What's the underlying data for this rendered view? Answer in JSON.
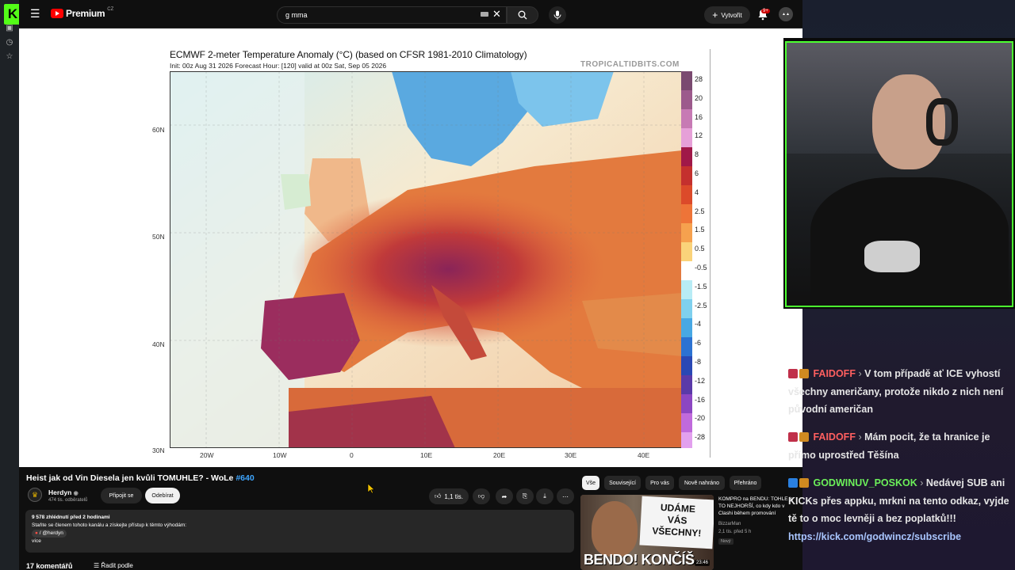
{
  "topbar": {
    "brand": "Premium",
    "region": "CZ",
    "search_value": "g mma",
    "create_label": "Vytvořit",
    "notif_count": "9+"
  },
  "map": {
    "title": "ECMWF 2-meter Temperature Anomaly (°C) (based on CFSR 1981-2010 Climatology)",
    "subtitle": "Init: 00z Aug 31 2026   Forecast Hour: [120]   valid at 00z Sat, Sep 05 2026",
    "credit": "TROPICALTIDBITS.COM",
    "colorbar_labels": [
      "28",
      "20",
      "16",
      "12",
      "8",
      "6",
      "4",
      "2.5",
      "1.5",
      "0.5",
      "-0.5",
      "-1.5",
      "-2.5",
      "-4",
      "-6",
      "-8",
      "-12",
      "-16",
      "-20",
      "-28"
    ],
    "lat_labels": [
      "60N",
      "50N",
      "40N",
      "30N"
    ],
    "lon_labels": [
      "20W",
      "10W",
      "0",
      "10E",
      "20E",
      "30E",
      "40E"
    ]
  },
  "video": {
    "title": "Heist jak od Vin Diesela jen kvůli TOMUHLE? - WoLe",
    "title_tag": "#640",
    "channel": "Herdyn",
    "subscribers": "474 tis. odběratelů",
    "join_label": "Připojit se",
    "subscribe_label": "Odebírat",
    "likes": "1,1 tis.",
    "views_line": "9 578 zhlédnutí  před 2 hodinami",
    "desc_line": "Staňte se členem tohoto kanálu a získejte přístup k těmto výhodám:",
    "desc_handle": "/ @herdyn",
    "more_label": "více",
    "comments": "17 komentářů",
    "sort_label": "Řadit podle"
  },
  "related": {
    "chips": [
      "Vše",
      "Související",
      "Pro vás",
      "Nově nahráno",
      "Přehráno"
    ],
    "title": "KOMPRO na BENDU: TOHLE je TO NEJHORŠÍ, co kdy kdo v Clashi během promování",
    "channel": "BizzarMan",
    "meta": "2,1 tis.  před 5 h",
    "badge": "Nový",
    "duration": "23:46",
    "thumb_sign": [
      "UDÁME",
      "VÁS",
      "VŠECHNY!"
    ],
    "thumb_caption": "BENDO! KONČÍŠ"
  },
  "chat": [
    {
      "user": "FAIDOFF",
      "text": "V tom případě ať ICE vyhostí všechny američany, protože nikdo z nich není původní američan"
    },
    {
      "user": "FAIDOFF",
      "text": "Mám pocit, že ta hranice je přímo uprostřed Těšína"
    },
    {
      "user": "GODWINUV_POSKOK",
      "text": "Nedávej SUB ani KICKs přes appku, mrkni na tento odkaz, vyjde tě to o moc levněji a bez poplatků!!!",
      "link": "https://kick.com/godwincz/subscribe"
    }
  ],
  "colors": {
    "kick_green": "#53fc18",
    "yt_red": "#ff0000",
    "chat_user_red": "#ff5f5f",
    "chat_user_green": "#6cf05a"
  }
}
